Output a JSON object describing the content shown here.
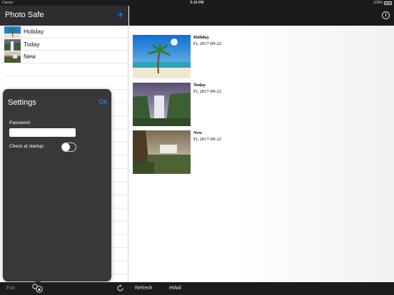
{
  "status_bar": {
    "carrier": "Carrier",
    "time": "5:34 PM",
    "battery": "100%"
  },
  "master": {
    "title": "Photo Safe",
    "add_icon": "plus-icon",
    "albums": [
      {
        "label": "Holiday",
        "thumb": "palm-beach"
      },
      {
        "label": "Today",
        "thumb": "waterfall"
      },
      {
        "label": "New",
        "thumb": "cliff-falls"
      }
    ]
  },
  "detail": {
    "info_icon": "info-icon",
    "photos": [
      {
        "name": "Holiday",
        "date": "Fr, 2017-09-22"
      },
      {
        "name": "Today",
        "date": "Fr, 2017-09-22"
      },
      {
        "name": "New",
        "date": "Fr, 2017-09-22"
      }
    ]
  },
  "settings": {
    "title": "Settings",
    "ok": "OK",
    "password_label": "Password:",
    "password_value": "",
    "check_label": "Check at startup:",
    "check_enabled": false
  },
  "toolbar": {
    "exit": "Exit",
    "security_icon": "shield-lock-icon",
    "refresh_icon": "refresh-icon",
    "refresh": "Refresh",
    "email": "eMail"
  },
  "colors": {
    "accent": "#2f8fff",
    "bar": "#1c1c1e",
    "popover": "#38383a"
  }
}
